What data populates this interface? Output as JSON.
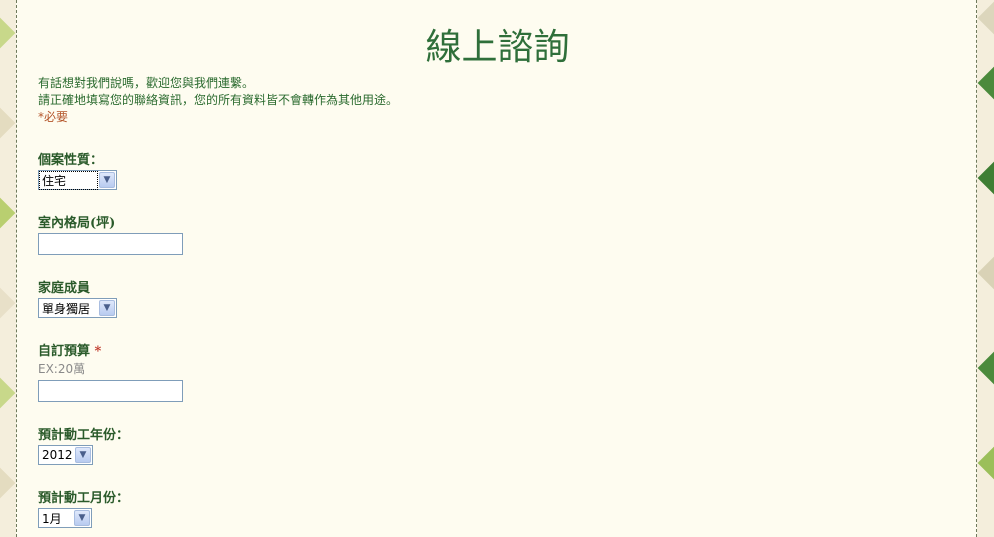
{
  "form": {
    "title": "線上諮詢",
    "intro_line1": "有話想對我們說嗎，歡迎您與我們連繫。",
    "intro_line2": "請正確地填寫您的聯絡資訊，您的所有資料皆不會轉作為其他用途。",
    "required_note": "*必要",
    "fields": {
      "case_type": {
        "label": "個案性質：",
        "value": "住宅"
      },
      "layout": {
        "label": "室內格局(坪)",
        "value": ""
      },
      "family": {
        "label": "家庭成員",
        "value": "單身獨居"
      },
      "budget": {
        "label": "自訂預算",
        "required_mark": "*",
        "hint": "EX:20萬",
        "value": ""
      },
      "year": {
        "label": "預計動工年份：",
        "value": "2012"
      },
      "month": {
        "label": "預計動工月份：",
        "value": "1月"
      }
    }
  },
  "colors": {
    "title": "#2f6f3a",
    "text": "#2a6a2e",
    "required": "#b4552a",
    "panel": "#fefcf0"
  },
  "icons": {
    "dropdown": "chevron-down-icon"
  }
}
